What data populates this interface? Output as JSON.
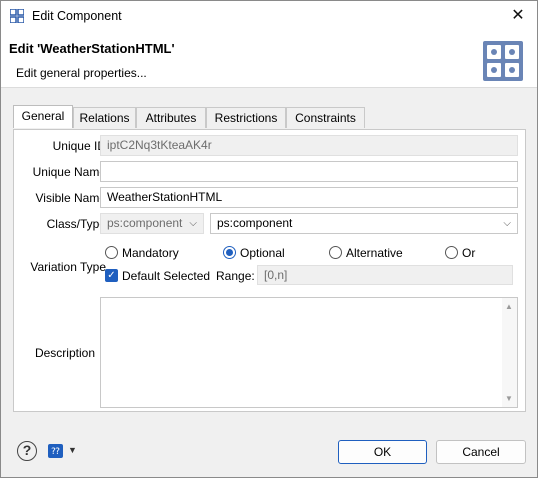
{
  "window": {
    "title": "Edit Component",
    "close_glyph": "✕"
  },
  "header": {
    "title": "Edit 'WeatherStationHTML'",
    "subtitle": "Edit general properties...",
    "icon": "grid-app-icon"
  },
  "tabs": [
    {
      "label": "General",
      "active": true
    },
    {
      "label": "Relations",
      "active": false
    },
    {
      "label": "Attributes",
      "active": false
    },
    {
      "label": "Restrictions",
      "active": false
    },
    {
      "label": "Constraints",
      "active": false
    }
  ],
  "form": {
    "unique_id": {
      "label": "Unique ID",
      "value": "iptC2Nq3tKteaAK4r"
    },
    "unique_name": {
      "label": "Unique Name",
      "value": ""
    },
    "visible_name": {
      "label": "Visible Name",
      "value": "WeatherStationHTML"
    },
    "class_type": {
      "label": "Class/Type",
      "class_value": "ps:component",
      "type_value": "ps:component"
    },
    "variation_type": {
      "label": "Variation Type",
      "options": [
        "Mandatory",
        "Optional",
        "Alternative",
        "Or"
      ],
      "selected": "Optional",
      "default_selected_label": "Default Selected",
      "default_selected": true,
      "range_label": "Range:",
      "range_value": "[0,n]"
    },
    "description": {
      "label": "Description",
      "value": ""
    }
  },
  "buttons": {
    "ok": "OK",
    "cancel": "Cancel"
  },
  "footer": {
    "help_glyph": "?",
    "small_icon_text": "⁇",
    "caret": "▼"
  },
  "colors": {
    "accent": "#1f5fbf",
    "panel_bg": "#ffffff",
    "window_bg": "#f0f0f0"
  }
}
